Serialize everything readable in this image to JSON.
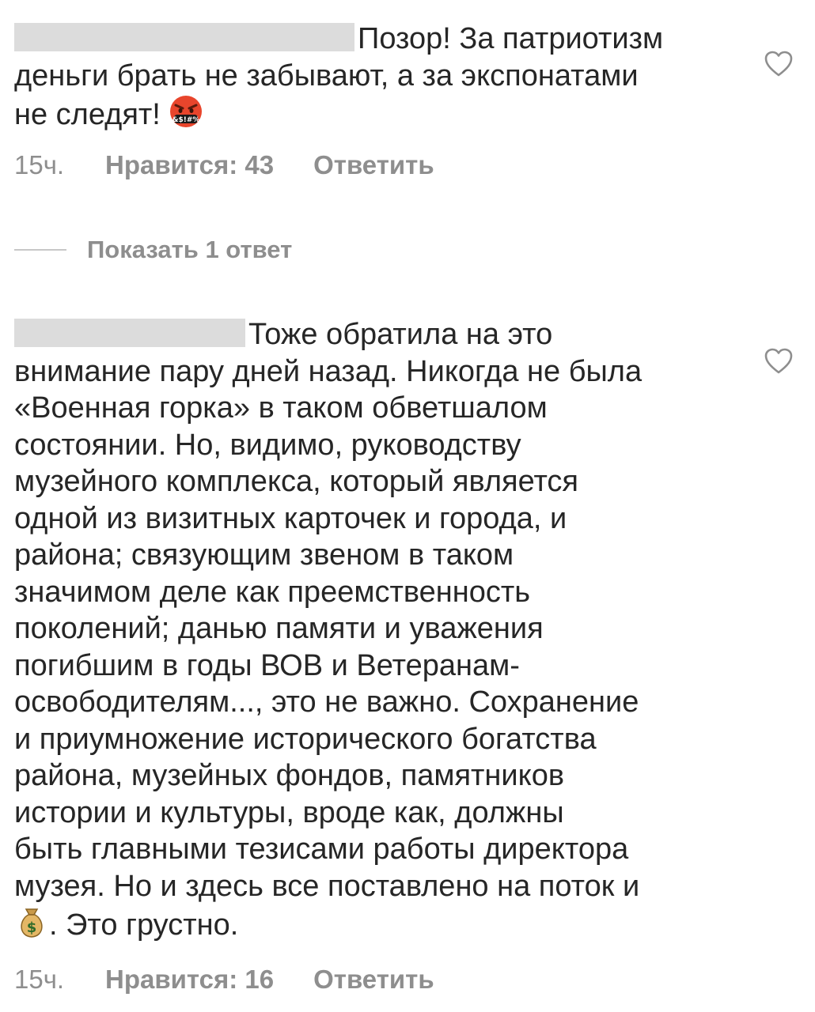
{
  "comments": [
    {
      "username_redacted": "",
      "text_lines": [
        "Позор! За патриотизм",
        "деньги брать не забывают, а за экспонатами",
        "не следят!"
      ],
      "emoji": "face-with-symbols-on-mouth",
      "time": "15ч.",
      "likes_label": "Нравится: 43",
      "reply_label": "Ответить",
      "liked": false
    },
    {
      "username_redacted": "",
      "text_lines": [
        "Тоже обратила на это",
        "внимание пару дней назад. Никогда не была",
        "«Военная горка» в таком обветшалом",
        "состоянии. Но, видимо, руководству",
        "музейного комплекса, который является",
        "одной из визитных карточек и города, и",
        "района; связующим звеном в таком",
        "значимом деле как преемственность",
        "поколений; данью памяти и уважения",
        "погибшим в годы ВОВ и  Ветеранам-",
        "освободителям..., это не важно. Сохранение",
        "и приумножение исторического богатства",
        "района, музейных фондов, памятников",
        "истории и культуры, вроде как, должны",
        "быть главными тезисами работы директора",
        "музея. Но и здесь все поставлено на поток и",
        ". Это грустно."
      ],
      "emoji": "money-bag",
      "time": "15ч.",
      "likes_label": "Нравится: 16",
      "reply_label": "Ответить",
      "liked": false
    }
  ],
  "show_replies_label": "Показать 1 ответ",
  "colors": {
    "text": "#262626",
    "meta": "#8e8e8e",
    "redaction": "#dcdcdc"
  }
}
